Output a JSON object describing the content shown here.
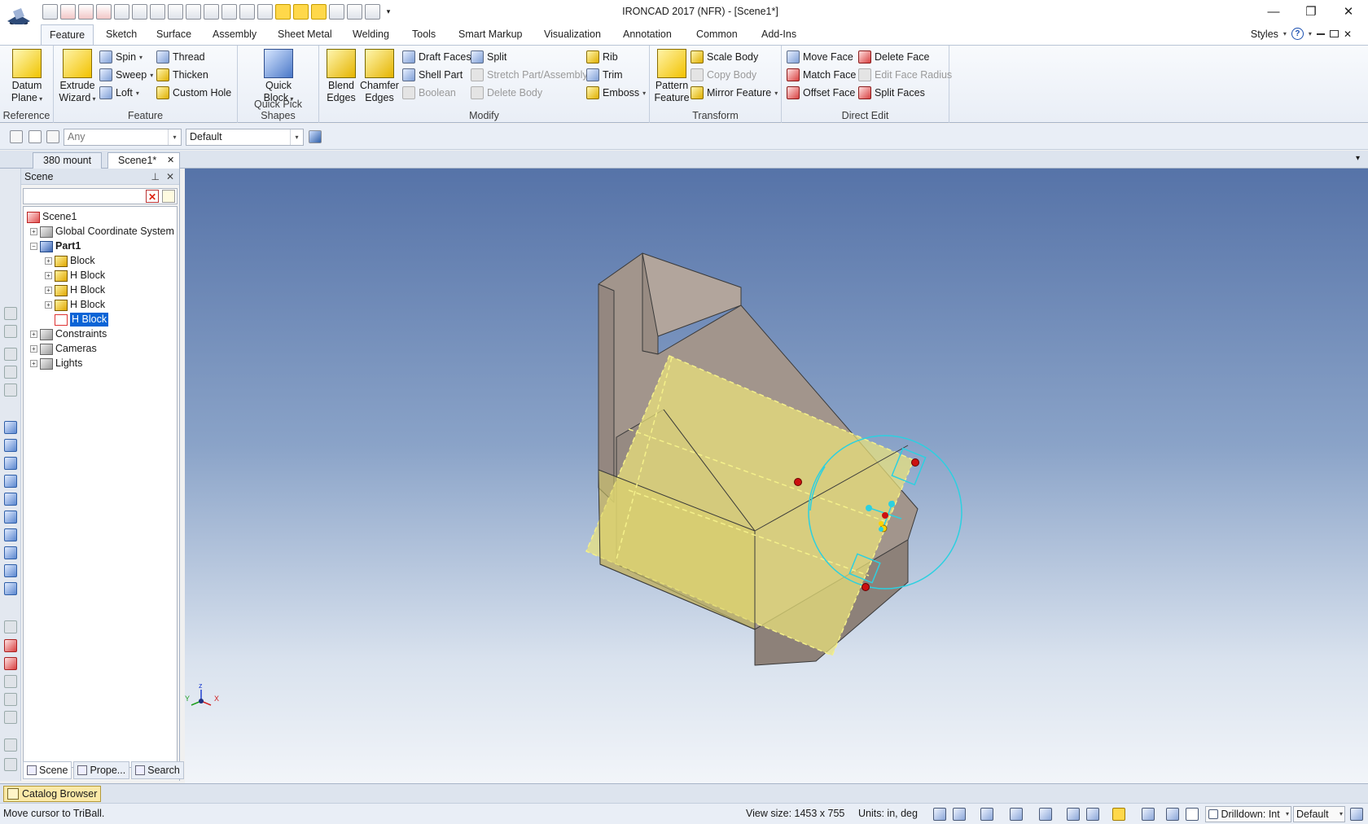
{
  "window": {
    "title": "IRONCAD 2017 (NFR) - [Scene1*]",
    "minimize": "—",
    "restore": "❐",
    "close": "✕"
  },
  "ribbon_tabs": [
    "Feature",
    "Sketch",
    "Surface",
    "Assembly",
    "Sheet Metal",
    "Welding",
    "Tools",
    "Smart Markup",
    "Visualization",
    "Annotation",
    "Common",
    "Add-Ins"
  ],
  "styles_label": "Styles",
  "ribbon": {
    "reference": {
      "label": "Reference",
      "datum_plane": [
        "Datum",
        "Plane"
      ]
    },
    "feature": {
      "label": "Feature",
      "extrude_wizard": [
        "Extrude",
        "Wizard"
      ],
      "spin": "Spin",
      "sweep": "Sweep",
      "loft": "Loft",
      "thread": "Thread",
      "thicken": "Thicken",
      "custom_hole": "Custom Hole"
    },
    "quick_pick": {
      "label": "Quick Pick Shapes",
      "quick_block": [
        "Quick",
        "Block"
      ]
    },
    "modify": {
      "label": "Modify",
      "blend_edges": [
        "Blend",
        "Edges"
      ],
      "chamfer_edges": [
        "Chamfer",
        "Edges"
      ],
      "draft_faces": "Draft Faces",
      "shell_part": "Shell Part",
      "boolean": "Boolean",
      "split": "Split",
      "stretch": "Stretch Part/Assembly",
      "delete_body": "Delete Body",
      "rib": "Rib",
      "trim": "Trim",
      "emboss": "Emboss"
    },
    "transform": {
      "label": "Transform",
      "pattern_feature": [
        "Pattern",
        "Feature"
      ],
      "scale_body": "Scale Body",
      "copy_body": "Copy Body",
      "mirror_feature": "Mirror Feature"
    },
    "direct_edit": {
      "label": "Direct Edit",
      "move_face": "Move Face",
      "match_face": "Match Face",
      "offset_face": "Offset Face",
      "delete_face": "Delete Face",
      "edit_face_radius": "Edit Face Radius",
      "split_faces": "Split Faces"
    }
  },
  "toolbar": {
    "filter_value": "Any",
    "style_value": "Default"
  },
  "doc_tabs": [
    "380 mount",
    "Scene1*"
  ],
  "scene_panel": {
    "title": "Scene",
    "tree": [
      {
        "label": "Scene1",
        "depth": 0,
        "icon": "red"
      },
      {
        "label": "Global Coordinate System",
        "depth": 1,
        "icon": "gray"
      },
      {
        "label": "Part1",
        "depth": 1,
        "icon": "blue",
        "bold": true
      },
      {
        "label": "Block",
        "depth": 2,
        "icon": "yellow"
      },
      {
        "label": "H Block",
        "depth": 2,
        "icon": "yellow"
      },
      {
        "label": "H Block",
        "depth": 2,
        "icon": "yellow"
      },
      {
        "label": "H Block",
        "depth": 2,
        "icon": "yellow"
      },
      {
        "label": "H Block",
        "depth": 2,
        "icon": "outline",
        "selected": true
      },
      {
        "label": "Constraints",
        "depth": 1,
        "icon": "gray"
      },
      {
        "label": "Cameras",
        "depth": 1,
        "icon": "gray"
      },
      {
        "label": "Lights",
        "depth": 1,
        "icon": "gray"
      }
    ],
    "tabs": [
      "Scene",
      "Prope...",
      "Search"
    ]
  },
  "triad": {
    "z": "z",
    "y": "Y",
    "x": "X"
  },
  "catalog_browser": "Catalog Browser",
  "status": {
    "message": "Move cursor to TriBall.",
    "view_size": "View size: 1453 x  755",
    "units": "Units: in, deg",
    "drilldown": "Drilldown: Int",
    "style": "Default"
  },
  "colors": {
    "accent": "#0a64d6",
    "part_face": "#a89a90",
    "preview_face": "#e6e27a",
    "triball": "#2cd0e0",
    "handle_red": "#cc1010"
  }
}
